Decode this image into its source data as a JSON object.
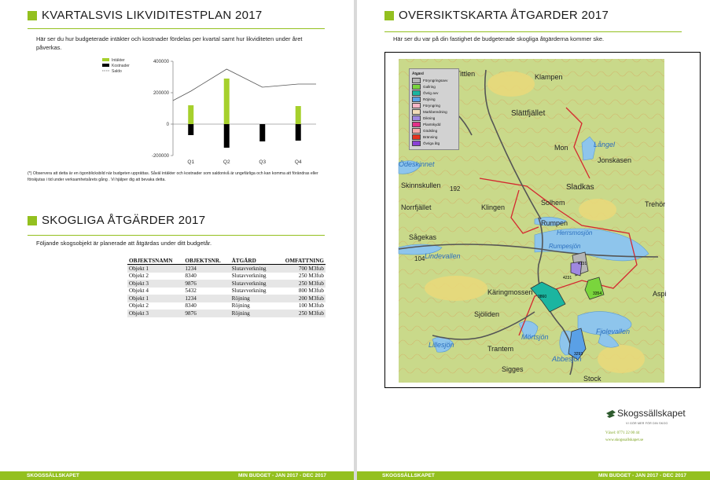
{
  "left": {
    "section1_title": "KVARTALSVIS LIKVIDITESTPLAN 2017",
    "section1_intro": "Här ser du hur budgeterade intäkter och kostnader fördelas per kvartal samt hur likviditeten under året påverkas.",
    "footnote": "(*) Observera att detta är en ögonblicksbild när budgeten upprättas. Såväl intäkter och kostnader som saldonivå är ungefärliga och kan komma att förändras eller förskjutas i tid under verksamhetsårets gång . Vi hjälper dig att bevaka detta.",
    "section2_title": "SKOGLIGA ÅTGÄRDER 2017",
    "section2_intro": "Följande skogsobjekt är planerade att åtgärdas under ditt budgetår.",
    "table": {
      "headers": [
        "OBJEKTSNAMN",
        "OBJEKTSNR.",
        "ÅTGÄRD",
        "OMFATTNING"
      ],
      "rows": [
        [
          "Objekt 1",
          "1234",
          "Slutavverkning",
          "700 M3fub"
        ],
        [
          "Objekt 2",
          "8340",
          "Slutavverkning",
          "250 M3fub"
        ],
        [
          "Objekt 3",
          "9876",
          "Slutavverkning",
          "250 M3fub"
        ],
        [
          "Objekt 4",
          "5432",
          "Slutavverkning",
          "800 M3fub"
        ],
        [
          "Objekt 1",
          "1234",
          "Röjning",
          "200 M3fub"
        ],
        [
          "Objekt 2",
          "8340",
          "Röjning",
          "100 M3fub"
        ],
        [
          "Objekt 3",
          "9876",
          "Röjning",
          "250 M3fub"
        ]
      ]
    },
    "footer_left": "SKOGSSÄLLSKAPET",
    "footer_right": "MIN BUDGET - JAN 2017 - DEC 2017"
  },
  "right": {
    "title": "OVERSIKTSKARTA ÅTGARDER 2017",
    "intro": "Här ser du var på din fastighet de budgeterade skogliga åtgärderna kommer ske.",
    "map": {
      "legend_title": "Åtgärd",
      "legend": [
        {
          "label": "Föryngringsavv",
          "color": "#b5b5b5"
        },
        {
          "label": "Gallring",
          "color": "#7ad53d"
        },
        {
          "label": "Övrig avv",
          "color": "#1bb5a0"
        },
        {
          "label": "Röjning",
          "color": "#5aa0e6"
        },
        {
          "label": "Föryngring",
          "color": "#f7b6c8"
        },
        {
          "label": "Markberedning",
          "color": "#f2ddb9"
        },
        {
          "label": "Dikning",
          "color": "#9f88e0"
        },
        {
          "label": "Plantskydd",
          "color": "#e2328a"
        },
        {
          "label": "Gödsling",
          "color": "#f4a9a9"
        },
        {
          "label": "Bränning",
          "color": "#e6321e"
        },
        {
          "label": "Övriga åtg",
          "color": "#8a3fd6"
        }
      ],
      "place_names": [
        "Klampen",
        "Tittlen",
        "Slättfjället",
        "Mon",
        "Långel",
        "Jonskasen",
        "Ödeskinnet",
        "Skinnskullen",
        "192",
        "Norrfjället",
        "Klingen",
        "Sladkas",
        "Solhem",
        "Trehör",
        "Rumpen",
        "Herrsmosjön",
        "Sågekas",
        "Rumpesjön",
        "Lindevallen",
        "104",
        "Käringmossen",
        "Sjöliden",
        "Lillesjön",
        "Trantem",
        "Mörtsjön",
        "Fjolevallen",
        "Abbesjön",
        "Sigges",
        "Stock",
        "Aspi"
      ],
      "objects": [
        "4131",
        "4231",
        "3860",
        "3354",
        "3293"
      ]
    },
    "brand_name": "Skogssällskapet",
    "brand_tagline": "VI GÖR MER FÖR DIN SKOG",
    "contact_phone": "Växel: 0771 22 00 44",
    "contact_web": "www.skogssallskapet.se",
    "footer_left": "SKOGSSÄLLSKAPET",
    "footer_right": "MIN BUDGET - JAN 2017 - DEC 2017"
  },
  "chart_data": {
    "type": "bar",
    "categories": [
      "Q1",
      "Q2",
      "Q3",
      "Q4"
    ],
    "series": [
      {
        "name": "Intäkter",
        "type": "bar",
        "color": "#a6d02c",
        "values": [
          120000,
          290000,
          0,
          115000
        ]
      },
      {
        "name": "Kostnader",
        "type": "bar",
        "color": "#000000",
        "values": [
          -70000,
          -150000,
          -110000,
          -105000
        ]
      },
      {
        "name": "Saldo",
        "type": "line",
        "style": "dashed",
        "color": "#555555",
        "values": [
          210000,
          350000,
          235000,
          255000
        ]
      }
    ],
    "yticks": [
      "400000",
      "200000",
      "0",
      "-200000"
    ],
    "ylim": [
      -200000,
      400000
    ],
    "legend_position": "top-left"
  }
}
